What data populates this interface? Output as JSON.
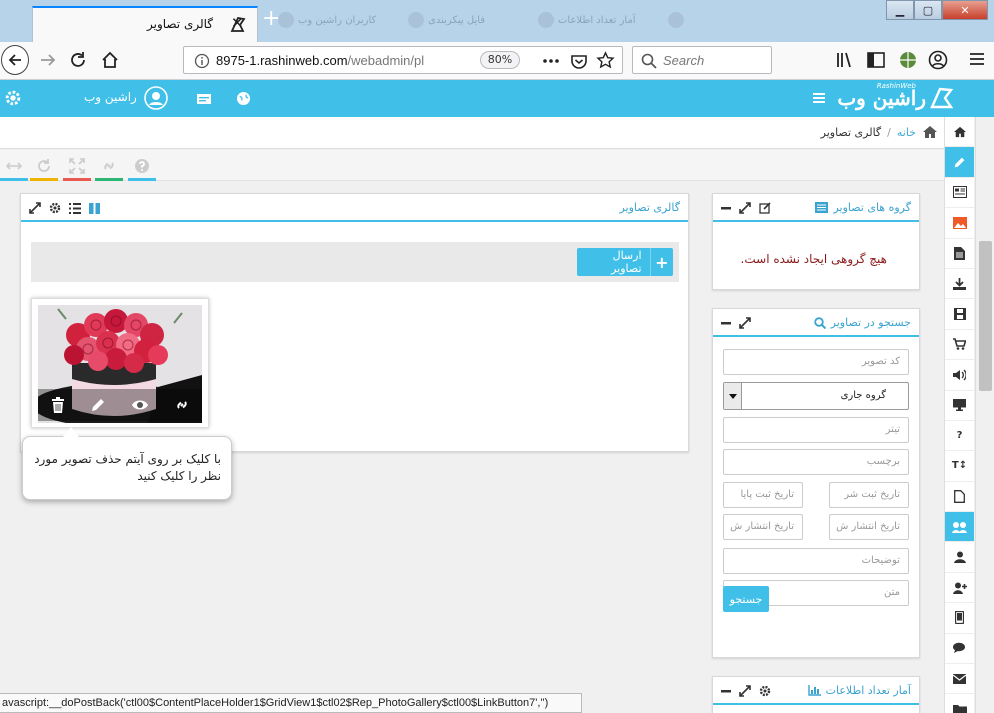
{
  "browser": {
    "tab_title": "گالری تصاویر",
    "close_glyph": "✕",
    "new_tab_glyph": "+",
    "inactive_tabs": [
      "کاربران راشین وب",
      "فایل پیکربندی",
      "آمار تعداد اطلاعات"
    ],
    "url_domain": "8975-1.rashinweb.com",
    "url_path": "/webadmin/pl",
    "zoom": "80%",
    "search_placeholder": "Search",
    "window_controls": {
      "min": "▁",
      "max": "▢",
      "close": "✕"
    }
  },
  "app": {
    "brand_name": "راشین وب",
    "brand_sub": "RashinWeb",
    "user_name": "راشین وب"
  },
  "breadcrumb": {
    "home": "خانه",
    "separator": "/",
    "current": "گالری تصاویر"
  },
  "toolstrip_colors": [
    "#40c0e8",
    "#f0b400",
    "#e85a4f",
    "#2bb673",
    "#40c0e8"
  ],
  "gallery_panel": {
    "title": "گالری تصاویر",
    "upload_label": "ارسال تصاویر",
    "plus": "+"
  },
  "tooltip": {
    "text": "با کلیک بر روی آیتم حذف تصویر مورد نظر را کلیک کنید"
  },
  "groups_panel": {
    "title": "گروه های تصاویر",
    "empty_message": "هیچ گروهی ایجاد نشده است."
  },
  "search_panel": {
    "title": "جستجو در تصاویر",
    "code_placeholder": "کد تصویر",
    "group_select": "گروه جاری",
    "title_placeholder": "تیتر",
    "tag_placeholder": "برچسب",
    "reg_start": "تاریخ ثبت شر",
    "reg_end": "تاریخ ثبت پایا",
    "pub_start": "تاریخ انتشار ش",
    "pub_end": "تاریخ انتشار ش",
    "desc_placeholder": "توضیحات",
    "text_placeholder": "متن",
    "search_button": "جستجو"
  },
  "stats_panel": {
    "title": "آمار تعداد اطلاعات"
  },
  "sidebar_icons": [
    "home-icon",
    "pencil-icon",
    "news-icon",
    "image-icon",
    "document-icon",
    "download-icon",
    "film-icon",
    "cart-icon",
    "volume-icon",
    "monitor-icon",
    "question-icon",
    "text-size-icon",
    "file-icon",
    "gallery-icon",
    "user-icon",
    "add-user-icon",
    "mobile-icon",
    "comments-icon",
    "mail-icon",
    "folder-icon"
  ],
  "sidebar_question": "?",
  "sidebar_text": "T↕",
  "colors": {
    "accent": "#40c0e8",
    "error_text": "#8b1a1a"
  },
  "status_text": "avascript:__doPostBack('ctl00$ContentPlaceHolder1$GridView1$ctl02$Rep_PhotoGallery$ctl00$LinkButton7','')"
}
